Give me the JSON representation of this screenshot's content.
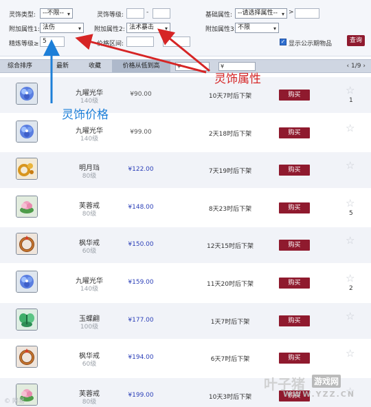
{
  "filters": {
    "type_label": "灵饰类型:",
    "type_value": "--不限--",
    "level_label": "灵饰等级:",
    "level_min": "",
    "level_max": "",
    "level_dash": "-",
    "base_attr_label": "基础属性:",
    "base_attr_value": "--请选择属性--",
    "base_attr_gt": ">",
    "base_attr_input": "",
    "attr1_label": "附加属性1:",
    "attr1_value": "法伤",
    "attr2_label": "附加属性2:",
    "attr2_value": "法术暴击",
    "attr3_label": "附加属性3:",
    "attr3_value": "不限",
    "refine_label": "精炼等级≥",
    "refine_value": "5",
    "price_label": "价格区间:",
    "price_min": "",
    "price_max": "",
    "show_public_label": "显示公示期物品",
    "search_button": "查询"
  },
  "sortbar": {
    "tabs": [
      "综合排序",
      "最新",
      "收藏",
      "价格从低到高"
    ],
    "price_from": "¥",
    "price_to": "¥",
    "pager": "1/9"
  },
  "annotations": {
    "red": "灵饰属性",
    "blue": "灵饰价格"
  },
  "items": [
    {
      "name": "九曜光华",
      "level": "140级",
      "price": "¥90.00",
      "time": "10天7时后下架",
      "buy": "购买",
      "count": "1",
      "icon": "crystal-flower-icon"
    },
    {
      "name": "九曜光华",
      "level": "140级",
      "price": "¥99.00",
      "time": "2天18时后下架",
      "buy": "购买",
      "count": "",
      "icon": "crystal-flower-icon"
    },
    {
      "name": "明月珰",
      "level": "80级",
      "price": "¥122.00",
      "time": "7天19时后下架",
      "buy": "购买",
      "count": "",
      "icon": "gold-earring-icon"
    },
    {
      "name": "芙蓉戒",
      "level": "80级",
      "price": "¥148.00",
      "time": "8天23时后下架",
      "buy": "购买",
      "count": "5",
      "icon": "lotus-ring-icon"
    },
    {
      "name": "枫华戒",
      "level": "60级",
      "price": "¥150.00",
      "time": "12天15时后下架",
      "buy": "购买",
      "count": "",
      "icon": "maple-ring-icon"
    },
    {
      "name": "九曜光华",
      "level": "140级",
      "price": "¥159.00",
      "time": "11天20时后下架",
      "buy": "购买",
      "count": "2",
      "icon": "crystal-flower-icon"
    },
    {
      "name": "玉蝶翩",
      "level": "100级",
      "price": "¥177.00",
      "time": "1天7时后下架",
      "buy": "购买",
      "count": "",
      "icon": "jade-butterfly-icon"
    },
    {
      "name": "枫华戒",
      "level": "60级",
      "price": "¥194.00",
      "time": "6天7时后下架",
      "buy": "购买",
      "count": "",
      "icon": "maple-ring-icon"
    },
    {
      "name": "芙蓉戒",
      "level": "80级",
      "price": "¥199.00",
      "time": "10天3时后下架",
      "buy": "购买",
      "count": "",
      "icon": "lotus-ring-icon"
    }
  ],
  "watermark": {
    "brand": "叶子猪",
    "sub": "游戏网",
    "url": "WWW.YZZ.CN"
  },
  "credit": "© 网易"
}
